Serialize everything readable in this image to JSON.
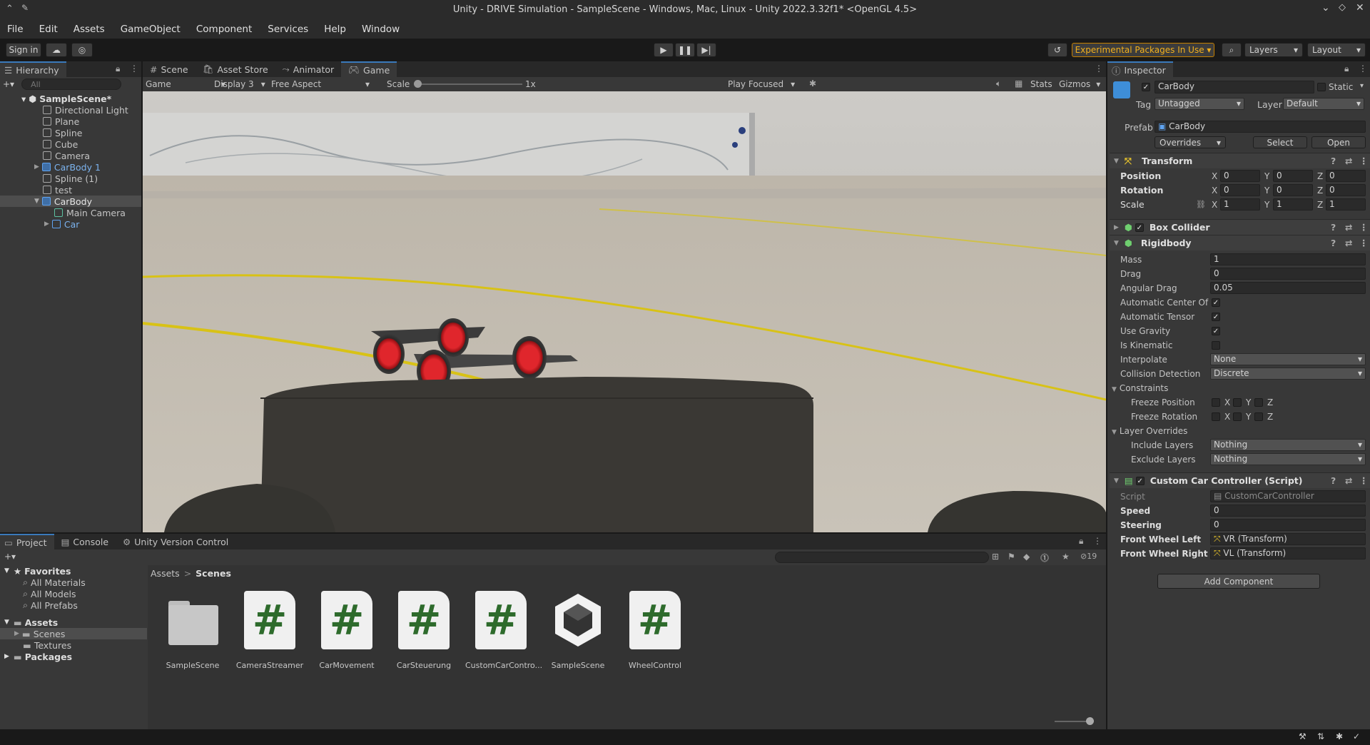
{
  "window": {
    "title": "Unity - DRIVE Simulation - SampleScene - Windows, Mac, Linux - Unity 2022.3.32f1* <OpenGL 4.5>"
  },
  "menu": [
    "File",
    "Edit",
    "Assets",
    "GameObject",
    "Component",
    "Services",
    "Help",
    "Window"
  ],
  "toolbar": {
    "sign_in": "Sign in",
    "experimental": "Experimental Packages In Use",
    "layers": "Layers",
    "layout": "Layout"
  },
  "hierarchy": {
    "tab": "Hierarchy",
    "search_placeholder": "All",
    "items": [
      {
        "label": "SampleScene*"
      },
      {
        "label": "Directional Light"
      },
      {
        "label": "Plane"
      },
      {
        "label": "Spline"
      },
      {
        "label": "Cube"
      },
      {
        "label": "Camera"
      },
      {
        "label": "CarBody 1"
      },
      {
        "label": "Spline (1)"
      },
      {
        "label": "test"
      },
      {
        "label": "CarBody"
      },
      {
        "label": "Main Camera"
      },
      {
        "label": "Car"
      }
    ]
  },
  "center_tabs": [
    "Scene",
    "Asset Store",
    "Animator",
    "Game"
  ],
  "game_toolbar": {
    "mode": "Game",
    "display": "Display 3",
    "aspect": "Free Aspect",
    "scale_label": "Scale",
    "scale_value": "1x",
    "play_focused": "Play Focused",
    "stats": "Stats",
    "gizmos": "Gizmos"
  },
  "inspector": {
    "tab": "Inspector",
    "object_name": "CarBody",
    "static_label": "Static",
    "tag_label": "Tag",
    "tag_value": "Untagged",
    "layer_label": "Layer",
    "layer_value": "Default",
    "prefab_label": "Prefab",
    "prefab_value": "CarBody",
    "overrides": "Overrides",
    "select": "Select",
    "open": "Open",
    "transform": {
      "title": "Transform",
      "rows": [
        {
          "label": "Position",
          "x": "0",
          "y": "0",
          "z": "0"
        },
        {
          "label": "Rotation",
          "x": "0",
          "y": "0",
          "z": "0"
        },
        {
          "label": "Scale",
          "x": "1",
          "y": "1",
          "z": "1"
        }
      ]
    },
    "box_collider": "Box Collider",
    "rigidbody": {
      "title": "Rigidbody",
      "mass_label": "Mass",
      "mass": "1",
      "drag_label": "Drag",
      "drag": "0",
      "angular_drag_label": "Angular Drag",
      "angular_drag": "0.05",
      "auto_center_label": "Automatic Center Of M",
      "auto_tensor_label": "Automatic Tensor",
      "use_gravity_label": "Use Gravity",
      "is_kinematic_label": "Is Kinematic",
      "interpolate_label": "Interpolate",
      "interpolate": "None",
      "collision_label": "Collision Detection",
      "collision": "Discrete",
      "constraints_label": "Constraints",
      "freeze_pos_label": "Freeze Position",
      "freeze_rot_label": "Freeze Rotation",
      "layer_overrides_label": "Layer Overrides",
      "include_label": "Include Layers",
      "include": "Nothing",
      "exclude_label": "Exclude Layers",
      "exclude": "Nothing"
    },
    "script_comp": {
      "title": "Custom Car Controller (Script)",
      "script_label": "Script",
      "script": "CustomCarController",
      "speed_label": "Speed",
      "speed": "0",
      "steering_label": "Steering",
      "steering": "0",
      "fwl_label": "Front Wheel Left",
      "fwl": "VR (Transform)",
      "fwr_label": "Front Wheel Right",
      "fwr": "VL (Transform)"
    },
    "add_component": "Add Component"
  },
  "bottom_tabs": [
    "Project",
    "Console",
    "Unity Version Control"
  ],
  "project": {
    "favorites_label": "Favorites",
    "favorites": [
      "All Materials",
      "All Models",
      "All Prefabs"
    ],
    "assets_label": "Assets",
    "asset_folders": [
      "Scenes",
      "Textures"
    ],
    "packages_label": "Packages",
    "breadcrumb": [
      "Assets",
      "Scenes"
    ],
    "hidden_count": "19",
    "files": [
      {
        "name": "SampleScene",
        "kind": "folder"
      },
      {
        "name": "CameraStreamer",
        "kind": "script"
      },
      {
        "name": "CarMovement",
        "kind": "script"
      },
      {
        "name": "CarSteuerung",
        "kind": "script"
      },
      {
        "name": "CustomCarContro...",
        "kind": "script"
      },
      {
        "name": "SampleScene",
        "kind": "scene"
      },
      {
        "name": "WheelControl",
        "kind": "script"
      }
    ]
  }
}
